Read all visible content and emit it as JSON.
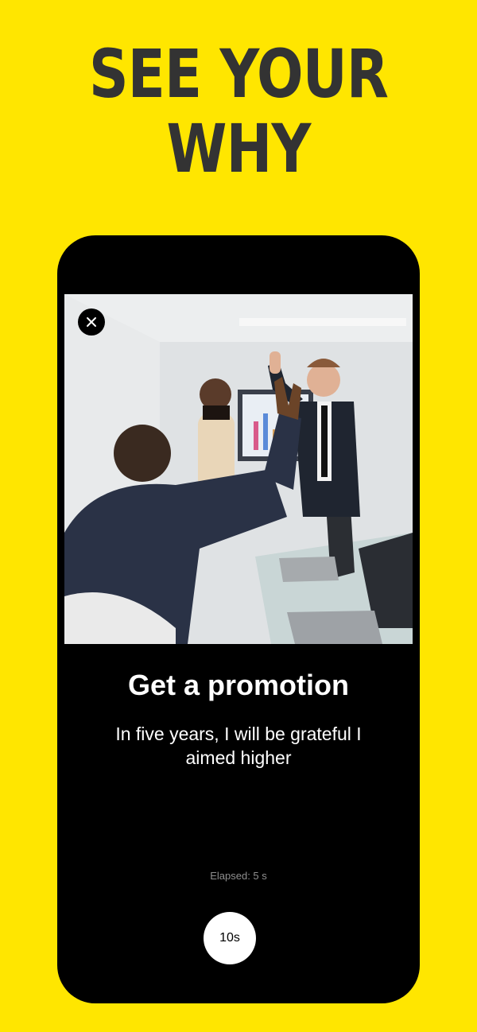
{
  "headline": {
    "line1": "SEE YOUR",
    "line2": "WHY"
  },
  "screen": {
    "close_icon": "close-icon",
    "goal_title": "Get a promotion",
    "goal_description": "In five years, I will be grateful I aimed higher",
    "elapsed": "Elapsed: 5 s",
    "timer_label": "10s"
  },
  "colors": {
    "background": "#FFE600",
    "headline": "#333333",
    "phone": "#000000",
    "timer_button": "#FFFFFF"
  }
}
